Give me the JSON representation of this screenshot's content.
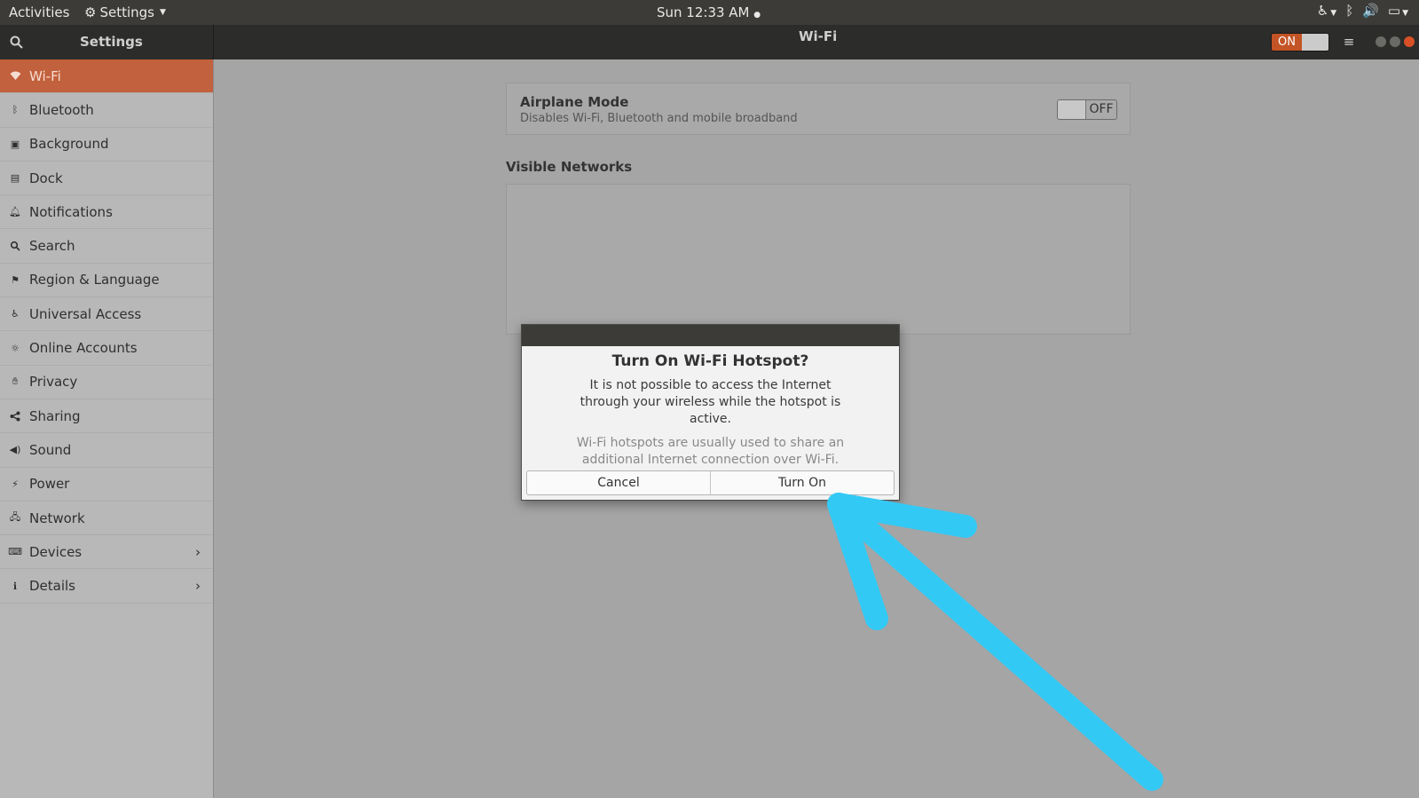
{
  "topbar": {
    "activities": "Activities",
    "app_menu": "Settings",
    "clock": "Sun 12:33 AM"
  },
  "header": {
    "left_title": "Settings",
    "center_title": "Wi-Fi",
    "hotspot_toggle": "ON"
  },
  "sidebar": {
    "items": [
      {
        "label": "Wi-Fi",
        "icon": "wifi-icon",
        "active": true
      },
      {
        "label": "Bluetooth",
        "icon": "bluetooth-icon"
      },
      {
        "label": "Background",
        "icon": "background-icon"
      },
      {
        "label": "Dock",
        "icon": "dock-icon"
      },
      {
        "label": "Notifications",
        "icon": "bell-icon"
      },
      {
        "label": "Search",
        "icon": "search-icon"
      },
      {
        "label": "Region & Language",
        "icon": "flag-icon"
      },
      {
        "label": "Universal Access",
        "icon": "accessibility-icon"
      },
      {
        "label": "Online Accounts",
        "icon": "online-accounts-icon"
      },
      {
        "label": "Privacy",
        "icon": "hand-icon"
      },
      {
        "label": "Sharing",
        "icon": "share-icon"
      },
      {
        "label": "Sound",
        "icon": "speaker-icon"
      },
      {
        "label": "Power",
        "icon": "power-icon"
      },
      {
        "label": "Network",
        "icon": "network-icon"
      },
      {
        "label": "Devices",
        "icon": "devices-icon",
        "chevron": true
      },
      {
        "label": "Details",
        "icon": "info-icon",
        "chevron": true
      }
    ]
  },
  "main": {
    "airplane": {
      "title": "Airplane Mode",
      "subtitle": "Disables Wi-Fi, Bluetooth and mobile broadband",
      "toggle": "OFF"
    },
    "visible_networks": "Visible Networks"
  },
  "dialog": {
    "title": "Turn On Wi-Fi Hotspot?",
    "message": "It is not possible to access the Internet through your wireless while the hotspot is active.",
    "secondary": "Wi-Fi hotspots are usually used to share an additional Internet connection over Wi-Fi.",
    "cancel": "Cancel",
    "confirm": "Turn On"
  },
  "colors": {
    "accent": "#c2613d",
    "annotation": "#33c9f5"
  }
}
